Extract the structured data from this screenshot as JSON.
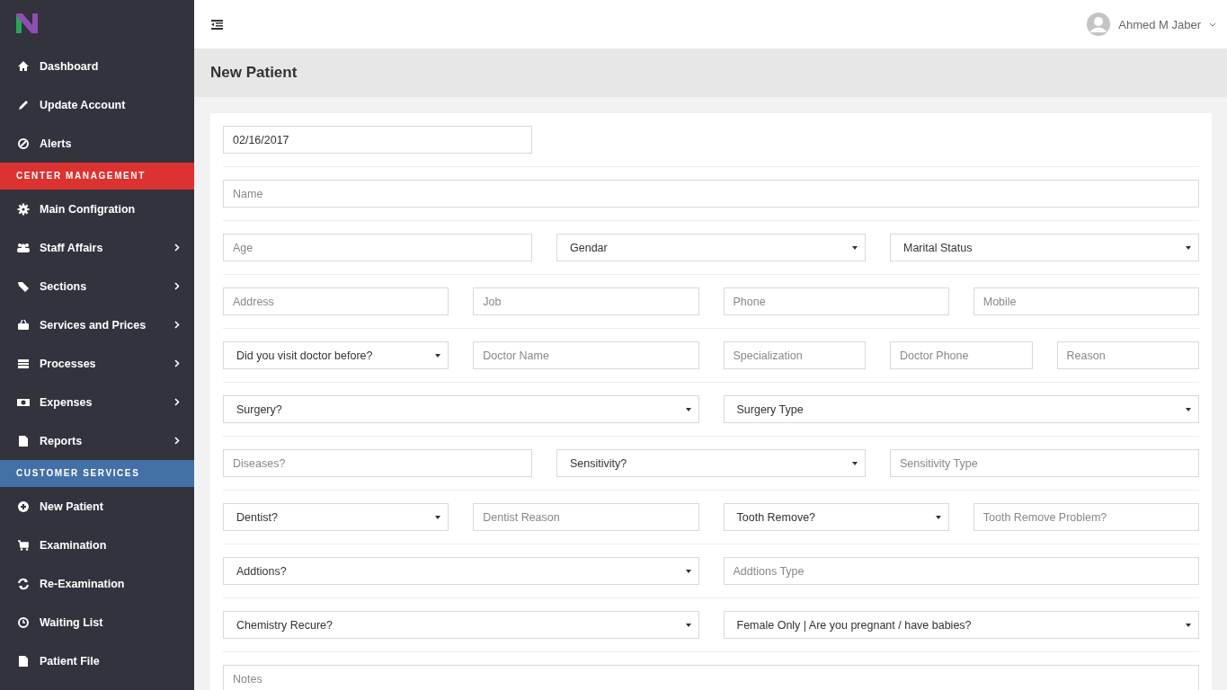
{
  "sidebar": {
    "items": [
      {
        "kind": "link",
        "label": "Dashboard",
        "has_submenu": false
      },
      {
        "kind": "link",
        "label": "Update Account",
        "has_submenu": false
      },
      {
        "kind": "link",
        "label": "Alerts",
        "has_submenu": false
      },
      {
        "kind": "section",
        "label": "CENTER MANAGEMENT",
        "color": "#dc3232"
      },
      {
        "kind": "link",
        "label": "Main Configration",
        "has_submenu": false
      },
      {
        "kind": "link",
        "label": "Staff Affairs",
        "has_submenu": true
      },
      {
        "kind": "link",
        "label": "Sections",
        "has_submenu": true
      },
      {
        "kind": "link",
        "label": "Services and Prices",
        "has_submenu": true
      },
      {
        "kind": "link",
        "label": "Processes",
        "has_submenu": true
      },
      {
        "kind": "link",
        "label": "Expenses",
        "has_submenu": true
      },
      {
        "kind": "link",
        "label": "Reports",
        "has_submenu": true
      },
      {
        "kind": "section",
        "label": "CUSTOMER SERVICES",
        "color": "#4370a7"
      },
      {
        "kind": "link",
        "label": "New Patient",
        "has_submenu": false
      },
      {
        "kind": "link",
        "label": "Examination",
        "has_submenu": false
      },
      {
        "kind": "link",
        "label": "Re-Examination",
        "has_submenu": false
      },
      {
        "kind": "link",
        "label": "Waiting List",
        "has_submenu": false
      },
      {
        "kind": "link",
        "label": "Patient File",
        "has_submenu": false
      }
    ]
  },
  "topbar": {
    "user": "Ahmed M Jaber"
  },
  "page_title": "New Patient",
  "form": {
    "rows": [
      [
        {
          "kind": "input",
          "value": "02/16/2017"
        }
      ],
      [
        {
          "kind": "input",
          "placeholder": "Name"
        }
      ],
      [
        {
          "kind": "input",
          "placeholder": "Age"
        },
        {
          "kind": "select",
          "value": "Gendar"
        },
        {
          "kind": "select",
          "value": "Marital Status"
        }
      ],
      [
        {
          "kind": "input",
          "placeholder": "Address"
        },
        {
          "kind": "input",
          "placeholder": "Job"
        },
        {
          "kind": "input",
          "placeholder": "Phone"
        },
        {
          "kind": "input",
          "placeholder": "Mobile"
        }
      ],
      [
        {
          "kind": "select",
          "value": "Did you visit doctor before?"
        },
        {
          "kind": "input",
          "placeholder": "Doctor Name"
        },
        {
          "kind": "input",
          "placeholder": "Specialization"
        },
        {
          "kind": "input",
          "placeholder": "Doctor Phone"
        },
        {
          "kind": "input",
          "placeholder": "Reason"
        }
      ],
      [
        {
          "kind": "select",
          "value": "Surgery?"
        },
        {
          "kind": "select",
          "value": "Surgery Type"
        }
      ],
      [
        {
          "kind": "input",
          "placeholder": "Diseases?"
        },
        {
          "kind": "select",
          "value": "Sensitivity?"
        },
        {
          "kind": "input",
          "placeholder": "Sensitivity Type"
        }
      ],
      [
        {
          "kind": "select",
          "value": "Dentist?"
        },
        {
          "kind": "input",
          "placeholder": "Dentist Reason"
        },
        {
          "kind": "select",
          "value": "Tooth Remove?"
        },
        {
          "kind": "input",
          "placeholder": "Tooth Remove Problem?"
        }
      ],
      [
        {
          "kind": "select",
          "value": "Addtions?"
        },
        {
          "kind": "input",
          "placeholder": "Addtions Type"
        }
      ],
      [
        {
          "kind": "select",
          "value": "Chemistry Recure?"
        },
        {
          "kind": "select",
          "value": "Female Only | Are you pregnant / have babies?"
        }
      ],
      [
        {
          "kind": "textarea",
          "placeholder": "Notes"
        }
      ]
    ]
  }
}
